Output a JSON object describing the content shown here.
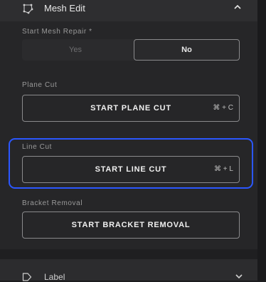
{
  "header": {
    "title": "Mesh Edit",
    "icon": "mesh-icon",
    "chevron": "chevron-up-icon"
  },
  "mesh_repair": {
    "label": "Start Mesh Repair *",
    "options": [
      "Yes",
      "No"
    ],
    "selected": "No"
  },
  "plane_cut": {
    "label": "Plane Cut",
    "button": "START PLANE CUT",
    "shortcut": "⌘ + C"
  },
  "line_cut": {
    "label": "Line Cut",
    "button": "START LINE CUT",
    "shortcut": "⌘ + L",
    "highlight_color": "#2b57ff"
  },
  "bracket_removal": {
    "label": "Bracket Removal",
    "button": "START BRACKET REMOVAL"
  },
  "footer": {
    "title": "Label",
    "icon": "label-tag-icon",
    "chevron": "chevron-down-icon"
  }
}
